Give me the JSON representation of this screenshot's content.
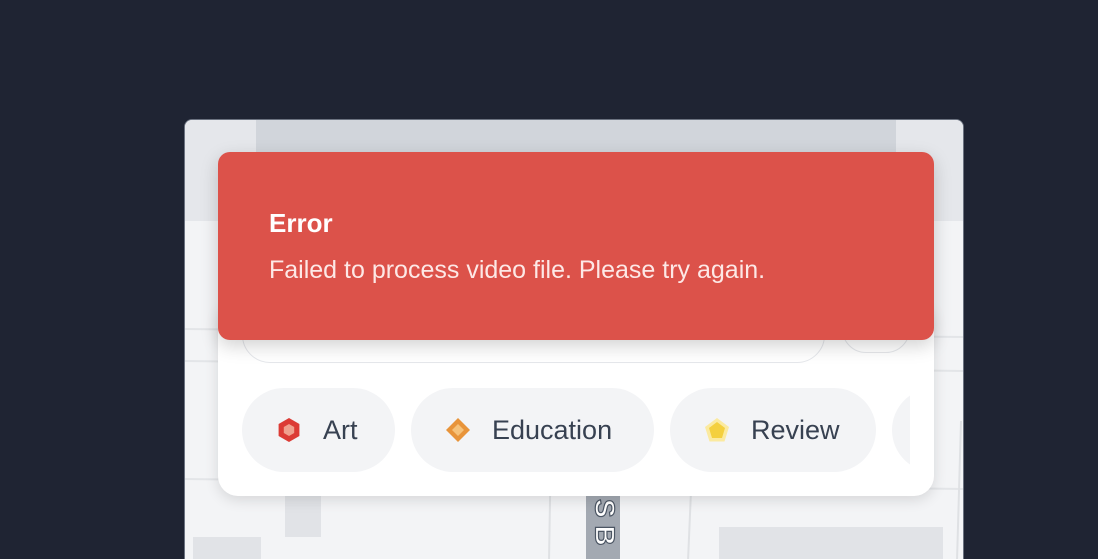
{
  "toast": {
    "type": "error",
    "title": "Error",
    "message": "Failed to process video file. Please try again.",
    "color": "#dc524a"
  },
  "map": {
    "street_label": "S B"
  },
  "categories": [
    {
      "label": "Art",
      "icon": "red-hexagon-icon",
      "color": "#dc3b35"
    },
    {
      "label": "Education",
      "icon": "orange-diamond-icon",
      "color": "#e8943a"
    },
    {
      "label": "Review",
      "icon": "yellow-pentagon-icon",
      "color": "#f4d03f"
    }
  ]
}
